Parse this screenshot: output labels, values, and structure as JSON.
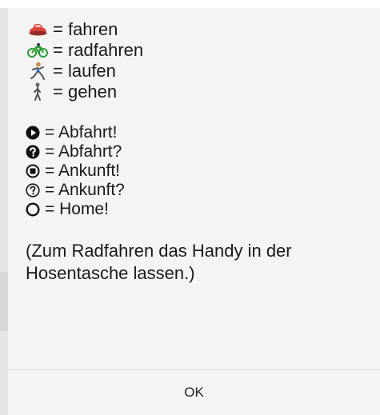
{
  "legend_modes": [
    {
      "icon": "car-icon",
      "label": "= fahren"
    },
    {
      "icon": "bicycle-icon",
      "label": "= radfahren"
    },
    {
      "icon": "runner-icon",
      "label": "= laufen"
    },
    {
      "icon": "walker-icon",
      "label": "= gehen"
    }
  ],
  "legend_states": [
    {
      "icon": "play-circle-icon",
      "label": "= Abfahrt!"
    },
    {
      "icon": "question-circle-filled-icon",
      "label": "= Abfahrt?"
    },
    {
      "icon": "stop-circle-icon",
      "label": "= Ankunft!"
    },
    {
      "icon": "question-circle-outline-icon",
      "label": "= Ankunft?"
    },
    {
      "icon": "circle-outline-icon",
      "label": "= Home!"
    }
  ],
  "note": "(Zum Radfahren das Handy in der Hosentasche lassen.)",
  "ok_button": "OK",
  "colors": {
    "dialog_background": "#f4f4f4",
    "text": "#1a1a1a",
    "car_red": "#e0443e",
    "bike_green": "#2e9e3a"
  }
}
